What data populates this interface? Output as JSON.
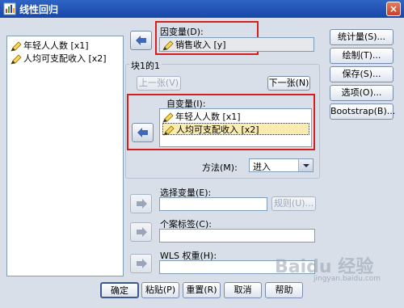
{
  "window": {
    "title": "线性回归",
    "close_glyph": "×"
  },
  "source_list": {
    "items": [
      {
        "label": "年轻人人数 [x1]",
        "icon": "ruler-pencil-icon"
      },
      {
        "label": "人均可支配收入 [x2]",
        "icon": "ruler-pencil-icon"
      }
    ]
  },
  "dependent": {
    "label": "因变量(D):",
    "value": "销售收入 [y]",
    "icon": "ruler-pencil-icon"
  },
  "block": {
    "label": "块1的1",
    "prev_label": "上一张(V)",
    "next_label": "下一张(N)"
  },
  "independent": {
    "label": "自变量(I):",
    "items": [
      {
        "label": "年轻人人数 [x1]",
        "icon": "ruler-pencil-icon",
        "selected": false
      },
      {
        "label": "人均可支配收入 [x2]",
        "icon": "ruler-pencil-icon",
        "selected": true
      }
    ]
  },
  "method": {
    "label": "方法(M):",
    "value": "进入"
  },
  "selection_variable": {
    "label": "选择变量(E):",
    "rule_label": "规则(U)...",
    "value": ""
  },
  "case_labels": {
    "label": "个案标签(C):",
    "value": ""
  },
  "wls_weight": {
    "label": "WLS 权重(H):",
    "value": ""
  },
  "side_buttons": [
    "统计量(S)...",
    "绘制(T)...",
    "保存(S)...",
    "选项(O)...",
    "Bootstrap(B)..."
  ],
  "bottom_buttons": [
    "确定",
    "粘贴(P)",
    "重置(R)",
    "取消",
    "帮助"
  ],
  "watermark": {
    "text": "Baidu 经验",
    "url": "jingyan.baidu.com"
  },
  "colors": {
    "title_bar": "#1847a8",
    "highlight_box": "#d41f1f",
    "selected_item": "#f9ecae",
    "dialog_bg": "#d8dfe8"
  }
}
